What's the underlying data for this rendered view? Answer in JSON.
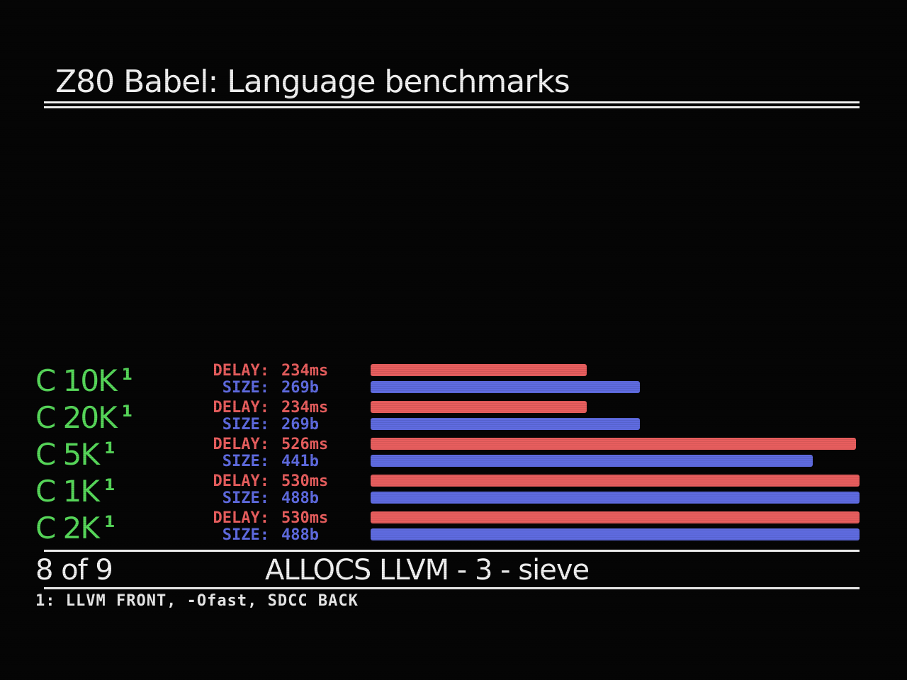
{
  "title": "Z80 Babel: Language benchmarks",
  "colors": {
    "background": "#050505",
    "text": "#f2f2f2",
    "label": "#57d85a",
    "delay": "#e85e5e",
    "size": "#5f6be0"
  },
  "footer": {
    "page": "8 of 9",
    "caption": "ALLOCS LLVM - 3 - sieve",
    "footnote": "1: LLVM FRONT, -Ofast, SDCC BACK"
  },
  "chart_data": {
    "type": "bar",
    "orientation": "horizontal",
    "categories": [
      "C 10K",
      "C 20K",
      "C 5K",
      "C 1K",
      "C 2K"
    ],
    "superscripts": [
      "1",
      "1",
      "1",
      "1",
      "1"
    ],
    "series": [
      {
        "name": "DELAY",
        "prefix": "DELAY:",
        "unit": "ms",
        "values": [
          234,
          234,
          526,
          530,
          530
        ],
        "labels": [
          "234ms",
          "234ms",
          "526ms",
          "530ms",
          "530ms"
        ]
      },
      {
        "name": "SIZE",
        "prefix": "SIZE:",
        "unit": "b",
        "values": [
          269,
          269,
          441,
          488,
          488
        ],
        "labels": [
          "269b",
          "269b",
          "441b",
          "488b",
          "488b"
        ]
      }
    ]
  }
}
